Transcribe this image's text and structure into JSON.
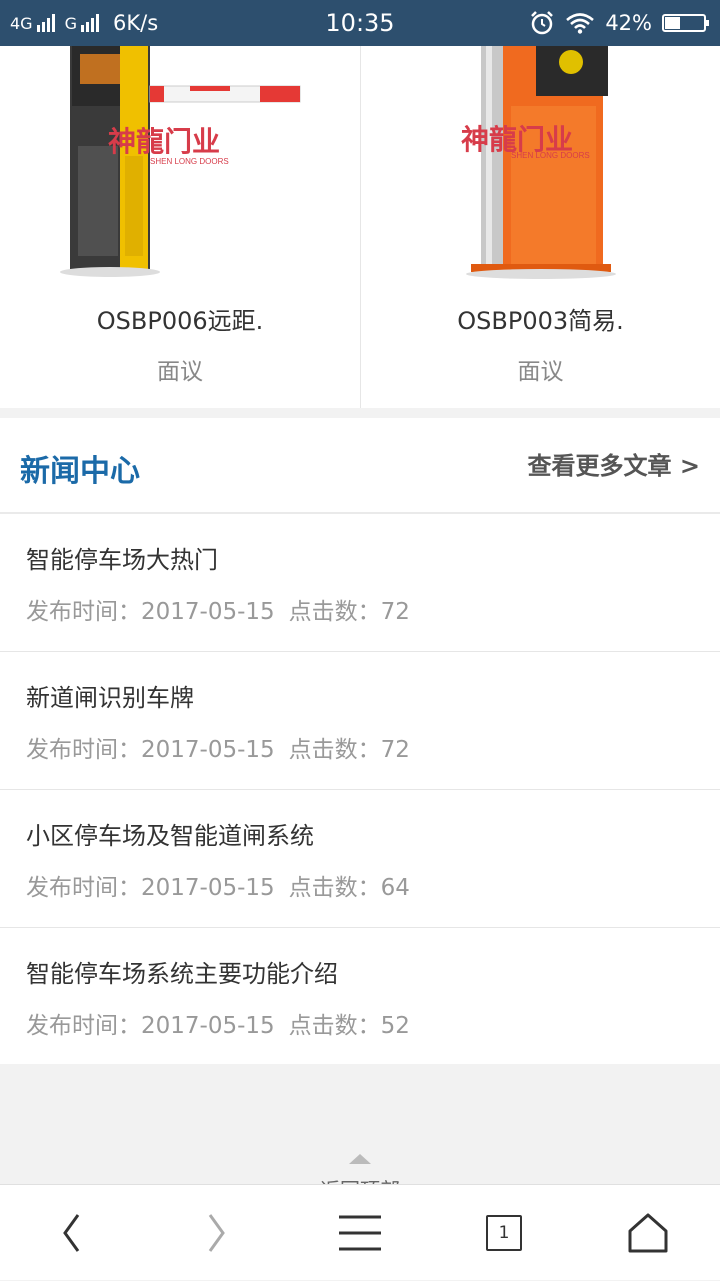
{
  "status_bar": {
    "network_1": "4G",
    "network_2": "G",
    "speed": "6K/s",
    "time": "10:35",
    "battery": "42%",
    "battery_level": 0.42,
    "icons": [
      "signal-icon",
      "alarm-icon",
      "wifi-icon",
      "battery-icon"
    ]
  },
  "products": [
    {
      "name": "OSBP006远距.",
      "price": "面议",
      "brand_logo": "神龍门业",
      "brand_logo_sub": "SHEN LONG DOORS",
      "image": "yellow-barrier-gate"
    },
    {
      "name": "OSBP003简易.",
      "price": "面议",
      "brand_logo": "神龍门业",
      "brand_logo_sub": "SHEN LONG DOORS",
      "image": "orange-barrier-gate"
    }
  ],
  "news": {
    "title": "新闻中心",
    "more": "查看更多文章 >",
    "items": [
      {
        "title": "智能停车场大热门",
        "date": "发布时间：2017-05-15",
        "clicks": "点击数：72"
      },
      {
        "title": "新道闸识别车牌",
        "date": "发布时间：2017-05-15",
        "clicks": "点击数：72"
      },
      {
        "title": "小区停车场及智能道闸系统",
        "date": "发布时间：2017-05-15",
        "clicks": "点击数：64"
      },
      {
        "title": "智能停车场系统主要功能介绍",
        "date": "发布时间：2017-05-15",
        "clicks": "点击数：52"
      }
    ]
  },
  "back_to_top": "返回顶部",
  "bottom_nav": {
    "tab_count": "1",
    "icons": [
      "back-icon",
      "forward-icon",
      "menu-icon",
      "tabs-icon",
      "home-icon"
    ]
  },
  "colors": {
    "status_bar": "#2d4f6e",
    "news_title": "#1b6aa8",
    "page_bg": "#f2f2f2"
  }
}
